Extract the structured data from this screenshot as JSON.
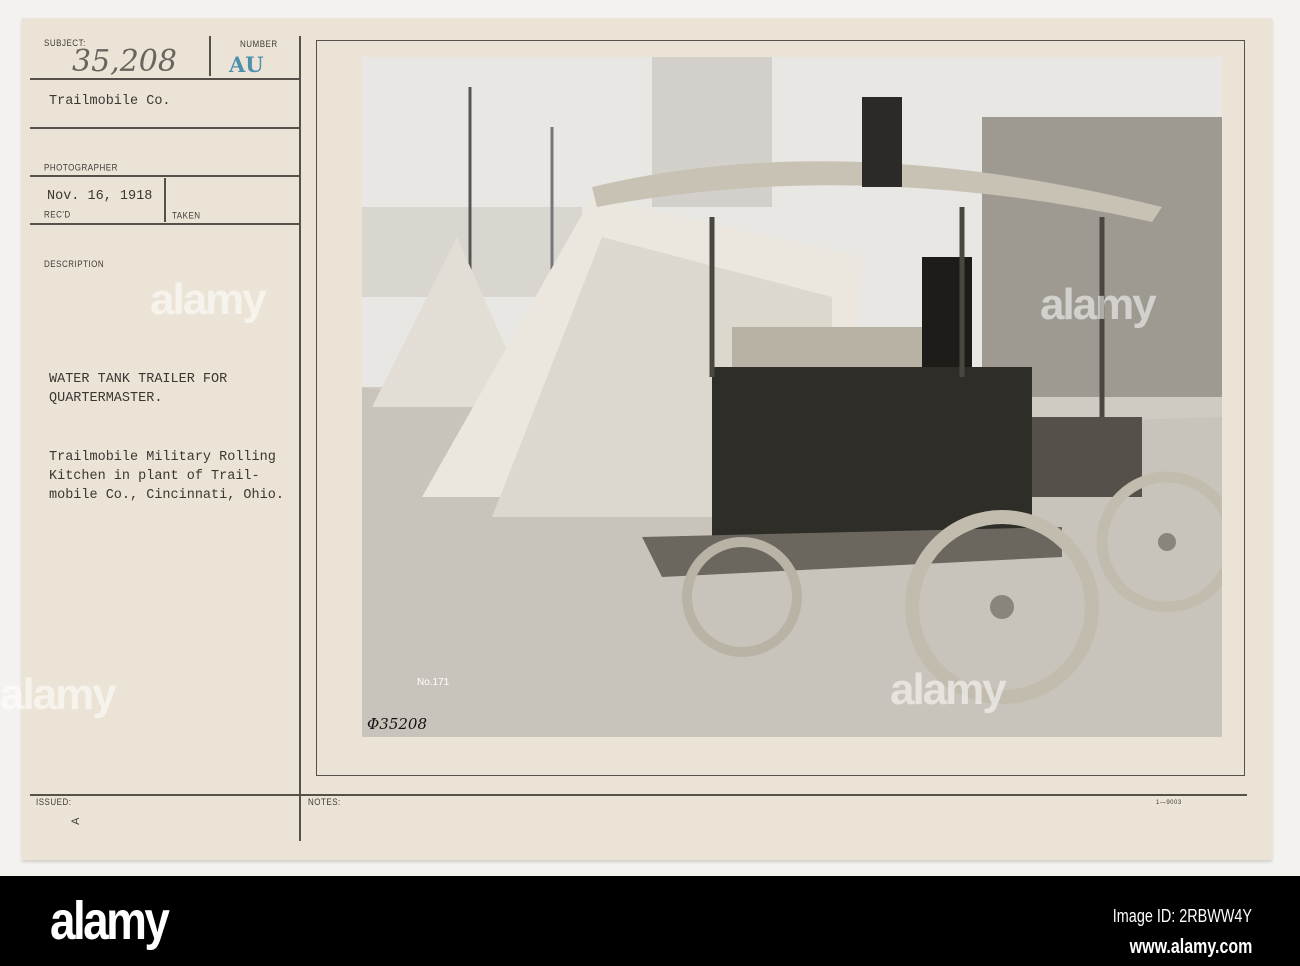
{
  "card": {
    "subject_label": "SUBJECT:",
    "subject_number": "35,208",
    "number_label": "NUMBER",
    "number_stamp": "AU",
    "company": "Trailmobile Co.",
    "photographer_label": "PHOTOGRAPHER",
    "date": "Nov. 16, 1918",
    "recd_label": "REC'D",
    "taken_label": "TAKEN",
    "description_label": "DESCRIPTION",
    "description_title": "WATER TANK TRAILER FOR\nQUARTERMASTER.",
    "description_body": "Trailmobile Military Rolling\nKitchen in plant of Trail-\nmobile Co., Cincinnati, Ohio.",
    "issued_label": "ISSUED:",
    "notes_label": "NOTES:",
    "form_number": "1—9003",
    "corner_mark": "A"
  },
  "photo": {
    "plate_label": "No.171",
    "handwritten_number": "Φ35208"
  },
  "watermark": {
    "tile_text": "alamy",
    "logo": "alamy",
    "image_id": "Image ID: 2RBWW4Y",
    "site": "www.alamy.com"
  }
}
